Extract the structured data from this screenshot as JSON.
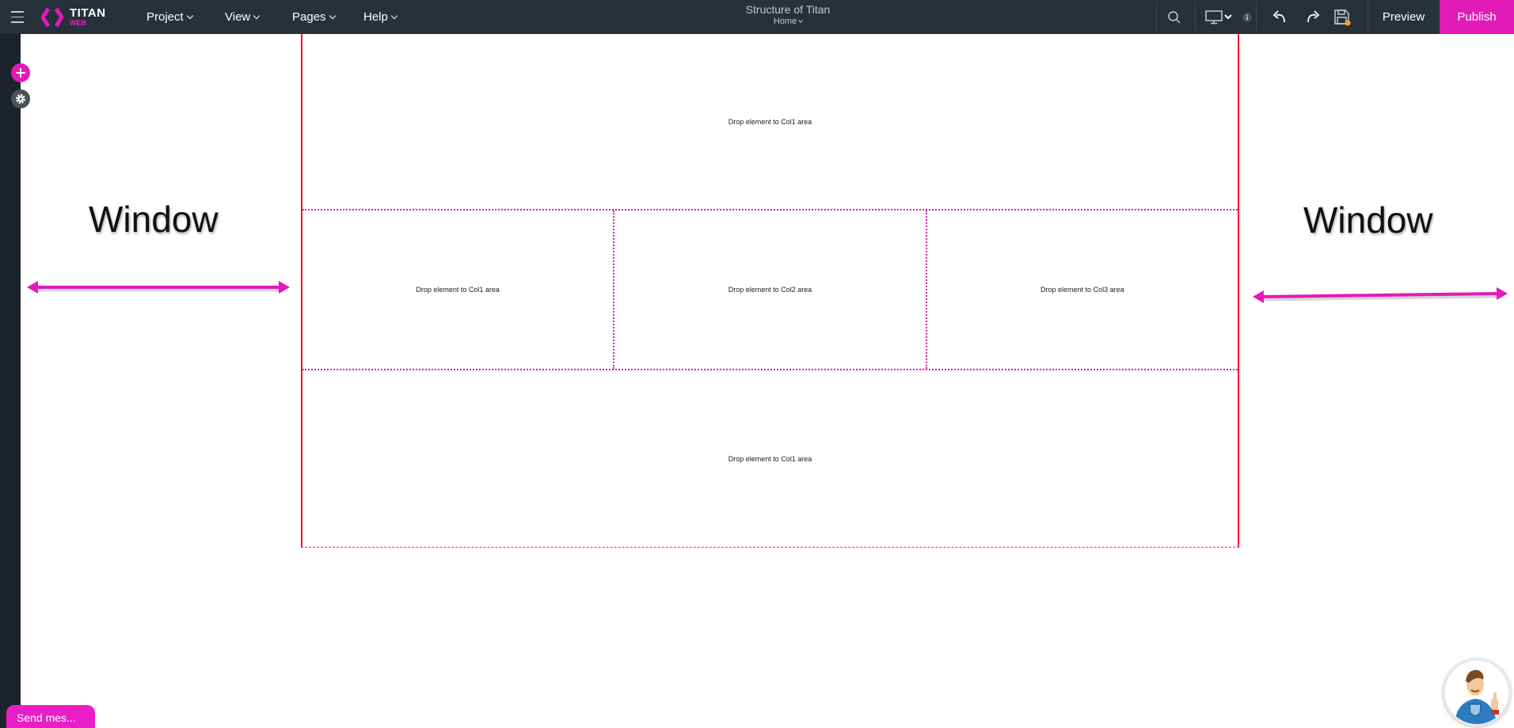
{
  "topbar": {
    "logo_title": "TITAN",
    "logo_sub": "WEB",
    "menus": [
      {
        "label": "Project"
      },
      {
        "label": "View"
      },
      {
        "label": "Pages"
      },
      {
        "label": "Help"
      }
    ],
    "project_title": "Structure of Titan",
    "current_page": "Home",
    "icons": [
      "hamburger-icon",
      "search-icon",
      "desktop-icon",
      "info-icon",
      "undo-icon",
      "redo-icon",
      "save-icon"
    ],
    "preview_label": "Preview",
    "publish_label": "Publish"
  },
  "colors": {
    "brand": "#e21ab8",
    "topbar_bg": "#27313a",
    "container_border": "#ff0a2a",
    "unsaved_dot": "#f5a623"
  },
  "canvas": {
    "rows": [
      {
        "cols": [
          {
            "label": "Drop element to Col1 area"
          }
        ]
      },
      {
        "cols": [
          {
            "label": "Drop element to Col1 area"
          },
          {
            "label": "Drop element to Col2 area"
          },
          {
            "label": "Drop element to Col3 area"
          }
        ]
      },
      {
        "cols": [
          {
            "label": "Drop element to Col1 area"
          }
        ]
      }
    ],
    "annotations": {
      "left_label": "Window",
      "right_label": "Window"
    }
  },
  "chat": {
    "send_message_label": "Send mes..."
  }
}
